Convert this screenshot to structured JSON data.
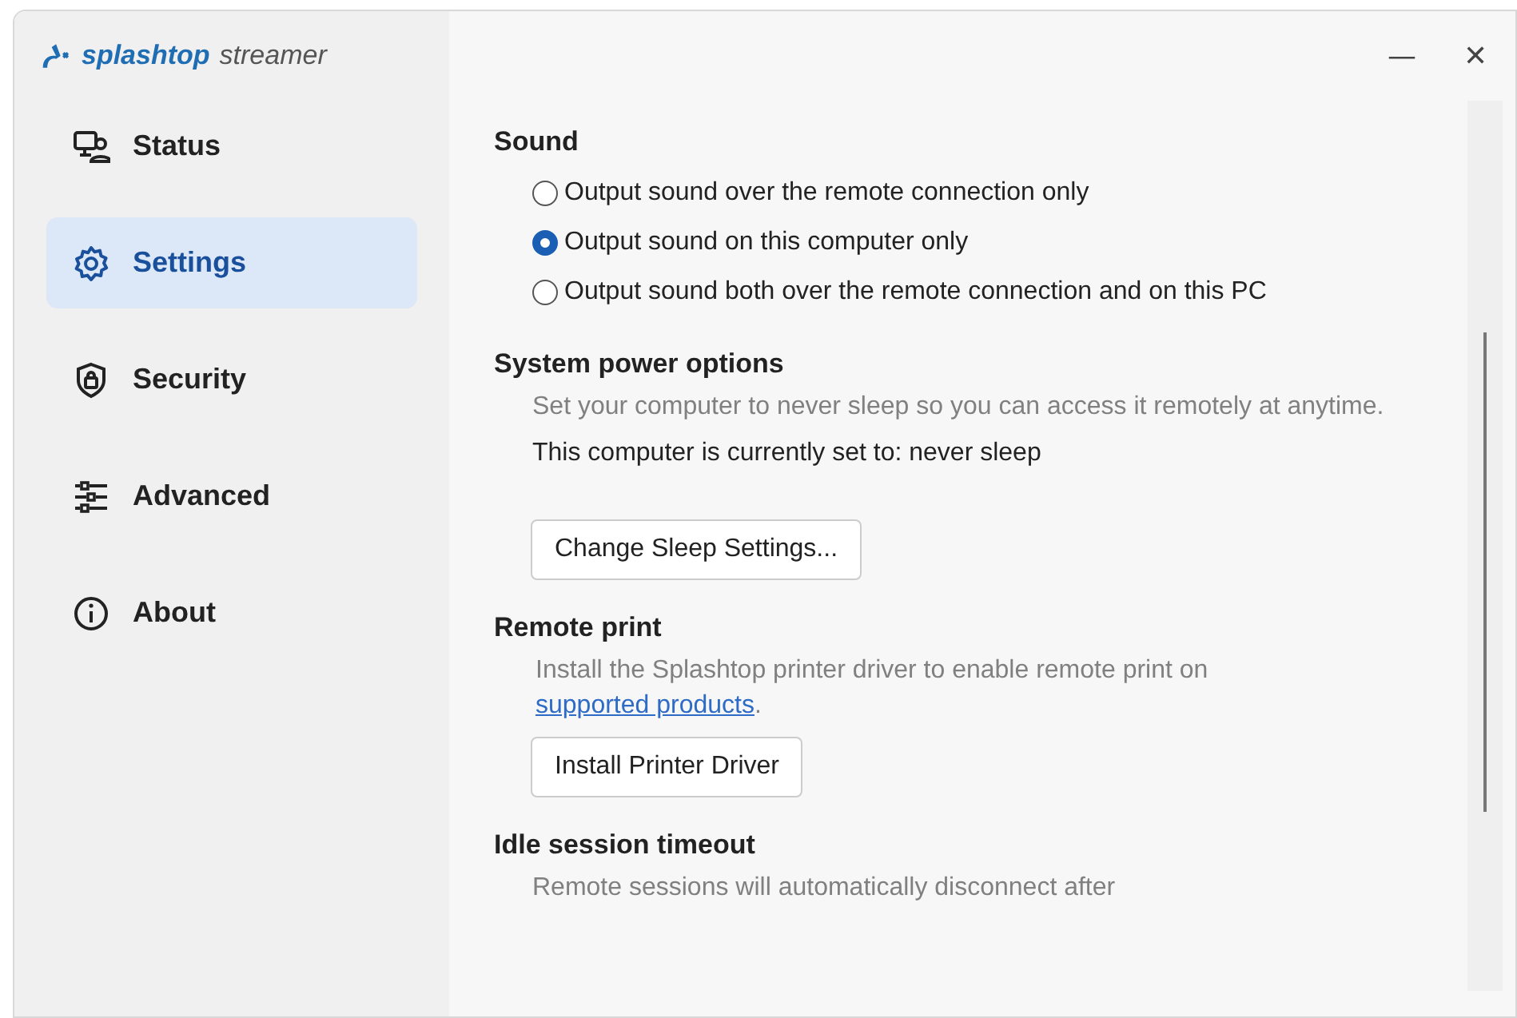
{
  "app": {
    "brand": "splashtop",
    "product": "streamer"
  },
  "window_controls": [
    "—",
    "✕"
  ],
  "sidebar": {
    "items": [
      {
        "label": "Status",
        "kind": "status",
        "selected": false
      },
      {
        "label": "Settings",
        "kind": "settings",
        "selected": true
      },
      {
        "label": "Security",
        "kind": "security",
        "selected": false
      },
      {
        "label": "Advanced",
        "kind": "advanced",
        "selected": false
      },
      {
        "label": "About",
        "kind": "about",
        "selected": false
      }
    ]
  },
  "sections": [
    {
      "title": "Sound",
      "items": [
        {
          "kind": "radio",
          "label": "Output sound over the remote connection only",
          "selected": false
        },
        {
          "kind": "radio",
          "label": "Output sound on this computer only",
          "selected": true
        },
        {
          "kind": "radio",
          "label": "Output sound both over the remote connection and on this PC",
          "selected": false
        }
      ]
    },
    {
      "title": "System power options",
      "items": [
        {
          "kind": "hint",
          "text": "Set your computer to never sleep so you can access it remotely at anytime."
        },
        {
          "kind": "text",
          "text": "This computer is currently set to: never sleep"
        },
        {
          "kind": "button",
          "label": "Change Sleep Settings..."
        }
      ]
    },
    {
      "title": "Remote print",
      "items": [
        {
          "kind": "hint_link",
          "text": "Install the Splashtop printer driver to enable remote print on",
          "link": "supported products",
          "after": "."
        },
        {
          "kind": "button",
          "label": "Install Printer Driver"
        }
      ]
    },
    {
      "title": "Idle session timeout",
      "items": [
        {
          "kind": "hint",
          "text": "Remote sessions will automatically disconnect after"
        }
      ]
    }
  ]
}
